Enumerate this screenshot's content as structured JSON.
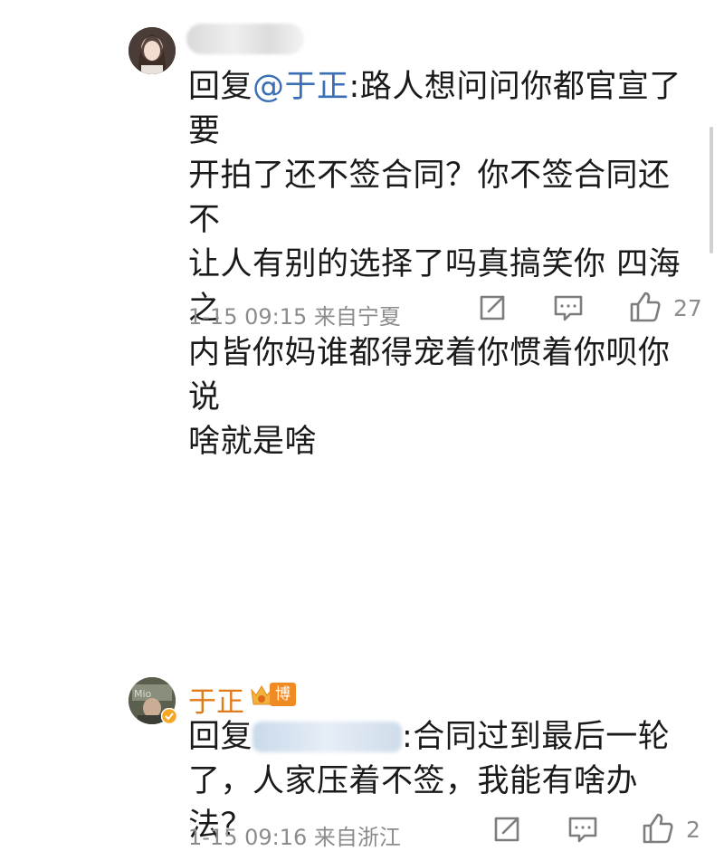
{
  "comments": [
    {
      "text_line1_prefix": "回复",
      "mention": "@于正",
      "text_line1_rest": ":路人想问问你都官宣了要",
      "text_line2": "开拍了还不签合同？你不签合同还不",
      "text_line3": "让人有别的选择了吗真搞笑你 四海之",
      "text_line4": "内皆你妈谁都得宠着你惯着你呗你说",
      "text_line5": "啥就是啥",
      "meta": "1-15 09:15 来自宁夏",
      "likes": "27"
    },
    {
      "author": "于正",
      "badge": "博主",
      "text_line1_prefix": "回复",
      "text_line1_rest": ":合同过到最后一轮",
      "text_line2": "了，人家压着不签，我能有啥办法？",
      "meta": "1-15 09:16 来自浙江",
      "likes": "2"
    }
  ],
  "icons": [
    "share-icon",
    "comment-icon",
    "like-icon",
    "crown-icon",
    "verified-icon"
  ],
  "colors": {
    "mention": "#3a6fb5",
    "author": "#e07a1a",
    "badge": "#f08b24",
    "meta": "#8c8c8c",
    "verified": "#f5a623"
  }
}
